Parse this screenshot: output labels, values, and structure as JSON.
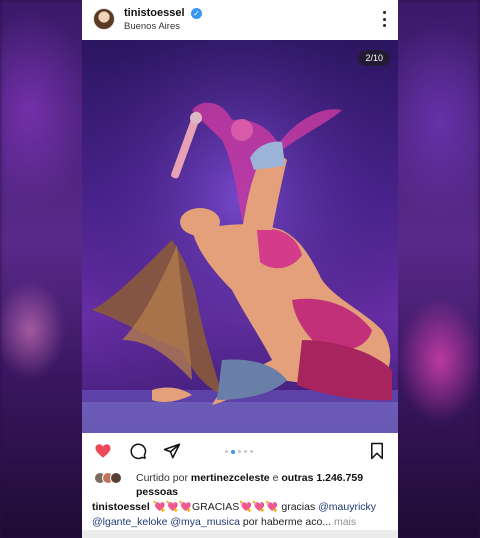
{
  "header": {
    "username": "tinistoessel",
    "location": "Buenos Aires"
  },
  "photo": {
    "counter": "2/10"
  },
  "carousel": {
    "current": 2,
    "total": 10
  },
  "actions": {
    "like_icon": "heart-filled-icon",
    "comment_icon": "comment-icon",
    "share_icon": "paper-plane-icon",
    "save_icon": "bookmark-icon",
    "like_color": "#ed4956"
  },
  "likes": {
    "prefix": "Curtido por ",
    "user": "mertinezceleste",
    "middle": " e ",
    "others": "outras 1.246.759 pessoas"
  },
  "caption": {
    "username": "tinistoessel",
    "hearts1": "💘💘💘",
    "word": "GRACIAS",
    "hearts2": "💘💘💘",
    "text1": " gracias ",
    "mention1": "@mauyricky",
    "mention2": "@lgante_keloke",
    "space": " ",
    "mention3": "@mya_musica",
    "text2": " por haberme aco...",
    "more": " mais"
  },
  "colors": {
    "accent": "#3897f0",
    "verified": "#3897f0"
  }
}
